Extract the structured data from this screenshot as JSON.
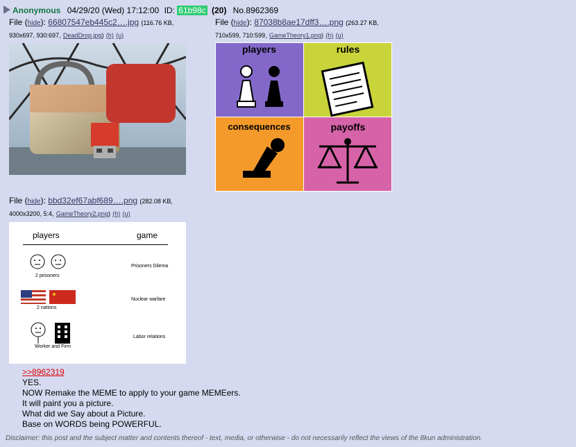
{
  "post": {
    "name": "Anonymous",
    "date": "04/29/20 (Wed) 17:12:00",
    "id_label": "ID:",
    "poster_id": "61b98c",
    "count": "(20)",
    "post_no": "No.8962369"
  },
  "files": [
    {
      "label": "File (",
      "hide": "hide",
      "sep": "):",
      "filename": "66807547eb445c2….jpg",
      "meta_line1": "(116.76 KB,",
      "meta_line2": "930x697, 930:697,",
      "original": "DeadDrop.jpg",
      "h": "(h)",
      "u": "(u)"
    },
    {
      "label": "File (",
      "hide": "hide",
      "sep": "):",
      "filename": "87038b8ae17dff3….png",
      "meta_line1": "(263.27 KB,",
      "meta_line2": "710x599, 710:599,",
      "original": "GameTheory1.png",
      "h": "(h)",
      "u": "(u)"
    },
    {
      "label": "File (",
      "hide": "hide",
      "sep": "):",
      "filename": "bbd32ef67abf689….png",
      "meta_line1": "(282.08 KB,",
      "meta_line2": "4000x3200, 5:4,",
      "original": "GameTheory2.png",
      "h": "(h)",
      "u": "(u)"
    }
  ],
  "image2": {
    "q1": "players",
    "q2": "rules",
    "q3": "consequences",
    "q4": "payoffs"
  },
  "image3": {
    "col_players": "players",
    "col_game": "game",
    "row1_caption": "2 prisoners",
    "row1_game": "Prisoners Dilema",
    "row2_caption": "2 nations",
    "row2_game": "Nuclear warfare",
    "row3_caption": "Worker and Firm",
    "row3_game": "Labor relations"
  },
  "body": {
    "quote": ">>8962319",
    "lines": [
      "YES.",
      "NOW Remake the MEME to apply to your game MEMEers.",
      "It will paint you a picture.",
      "What did we Say about a Picture.",
      "Base on WORDS being POWERFUL."
    ]
  },
  "disclaimer": "Disclaimer: this post and the subject matter and contents thereof - text, media, or otherwise - do not necessarily reflect the views of the 8kun administration."
}
